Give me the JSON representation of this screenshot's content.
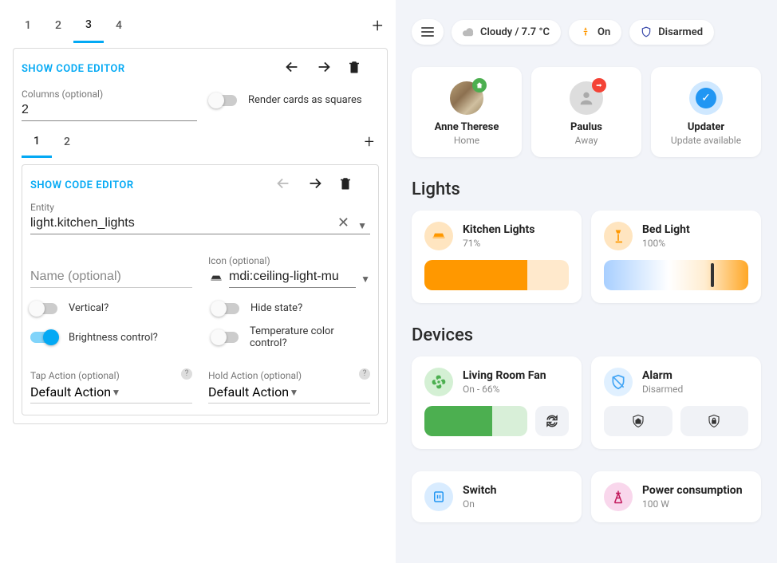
{
  "editor": {
    "tabs": [
      "1",
      "2",
      "3",
      "4"
    ],
    "activeTab": 2,
    "showCodeLabel": "SHOW CODE EDITOR",
    "columnsLabel": "Columns (optional)",
    "columnsValue": "2",
    "renderSquaresLabel": "Render cards as squares",
    "renderSquares": false,
    "inner": {
      "tabs": [
        "1",
        "2"
      ],
      "activeTab": 0,
      "showCodeLabel": "SHOW CODE EDITOR",
      "entityLabel": "Entity",
      "entityValue": "light.kitchen_lights",
      "nameLabel": "Name (optional)",
      "nameValue": "",
      "iconLabel": "Icon (optional)",
      "iconValue": "mdi:ceiling-light-mu",
      "toggles": {
        "vertical": {
          "label": "Vertical?",
          "on": false
        },
        "hideState": {
          "label": "Hide state?",
          "on": false
        },
        "brightness": {
          "label": "Brightness control?",
          "on": true
        },
        "tempColor": {
          "label": "Temperature color control?",
          "on": false
        }
      },
      "tapActionLabel": "Tap Action (optional)",
      "tapActionValue": "Default Action",
      "holdActionLabel": "Hold Action (optional)",
      "holdActionValue": "Default Action"
    }
  },
  "preview": {
    "chips": {
      "weather": "Cloudy / 7.7 °C",
      "on": "On",
      "disarmed": "Disarmed"
    },
    "persons": [
      {
        "name": "Anne Therese",
        "sub": "Home",
        "badge": "home"
      },
      {
        "name": "Paulus",
        "sub": "Away",
        "badge": "away"
      },
      {
        "name": "Updater",
        "sub": "Update available",
        "badge": "check"
      }
    ],
    "lightsHeader": "Lights",
    "lights": [
      {
        "name": "Kitchen Lights",
        "sub": "71%"
      },
      {
        "name": "Bed Light",
        "sub": "100%"
      }
    ],
    "devicesHeader": "Devices",
    "devices": {
      "fan": {
        "name": "Living Room Fan",
        "sub": "On - 66%"
      },
      "alarm": {
        "name": "Alarm",
        "sub": "Disarmed"
      },
      "switch": {
        "name": "Switch",
        "sub": "On"
      },
      "power": {
        "name": "Power consumption",
        "sub": "100 W"
      }
    }
  }
}
